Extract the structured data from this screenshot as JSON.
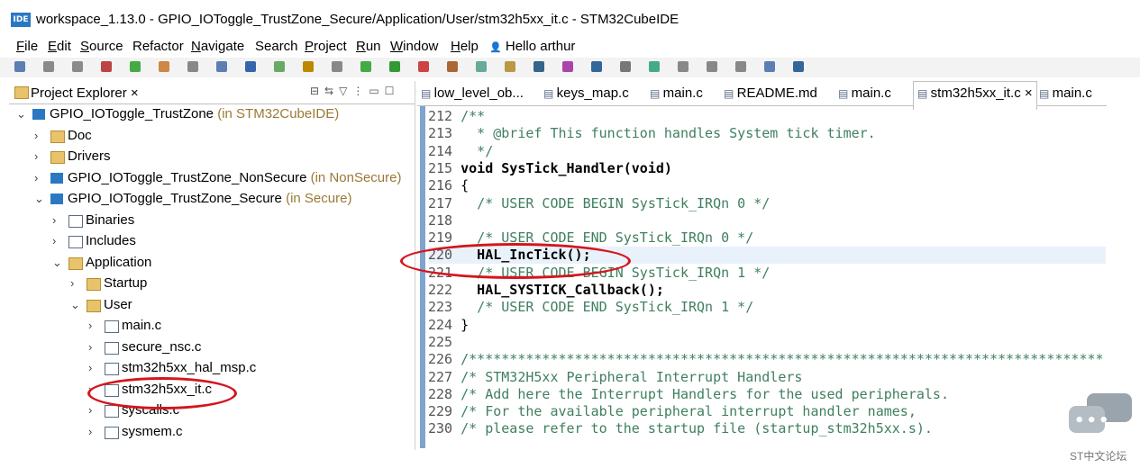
{
  "window": {
    "logo": "IDE",
    "title": "workspace_1.13.0 - GPIO_IOToggle_TrustZone_Secure/Application/User/stm32h5xx_it.c - STM32CubeIDE"
  },
  "menu": [
    {
      "label": "File",
      "key": "F",
      "rest": "ile"
    },
    {
      "label": "Edit",
      "key": "E",
      "rest": "dit"
    },
    {
      "label": "Source",
      "key": "S",
      "rest": "ource"
    },
    {
      "label": "Refactor",
      "key": "",
      "rest": "Refactor"
    },
    {
      "label": "Navigate",
      "key": "N",
      "rest": "avigate"
    },
    {
      "label": "Search",
      "key": "",
      "rest": "Search"
    },
    {
      "label": "Project",
      "key": "P",
      "rest": "roject"
    },
    {
      "label": "Run",
      "key": "R",
      "rest": "un"
    },
    {
      "label": "Window",
      "key": "W",
      "rest": "indow"
    },
    {
      "label": "Help",
      "key": "H",
      "rest": "elp"
    },
    {
      "label": "Hello arthur",
      "key": "",
      "rest": "Hello arthur"
    }
  ],
  "explorer": {
    "title": "Project Explorer",
    "close": "×",
    "items": [
      {
        "name": "GPIO_IOToggle_TrustZone",
        "suffix": " (in STM32CubeIDE)",
        "icon": "project-icon"
      },
      {
        "name": "Doc",
        "suffix": "",
        "icon": "folder-icon"
      },
      {
        "name": "Drivers",
        "suffix": "",
        "icon": "folder-icon"
      },
      {
        "name": "GPIO_IOToggle_TrustZone_NonSecure",
        "suffix": " (in NonSecure)",
        "icon": "project-icon"
      },
      {
        "name": "GPIO_IOToggle_TrustZone_Secure",
        "suffix": " (in Secure)",
        "icon": "project-icon"
      },
      {
        "name": "Binaries",
        "suffix": "",
        "icon": "binaries-icon"
      },
      {
        "name": "Includes",
        "suffix": "",
        "icon": "includes-icon"
      },
      {
        "name": "Application",
        "suffix": "",
        "icon": "folder-icon"
      },
      {
        "name": "Startup",
        "suffix": "",
        "icon": "folder-icon"
      },
      {
        "name": "User",
        "suffix": "",
        "icon": "folder-icon"
      },
      {
        "name": "main.c",
        "suffix": "",
        "icon": "c-file-icon"
      },
      {
        "name": "secure_nsc.c",
        "suffix": "",
        "icon": "c-file-icon"
      },
      {
        "name": "stm32h5xx_hal_msp.c",
        "suffix": "",
        "icon": "c-file-icon"
      },
      {
        "name": "stm32h5xx_it.c",
        "suffix": "",
        "icon": "c-file-icon"
      },
      {
        "name": "syscalls.c",
        "suffix": "",
        "icon": "c-file-icon"
      },
      {
        "name": "sysmem.c",
        "suffix": "",
        "icon": "c-file-icon"
      }
    ]
  },
  "tabs": [
    {
      "label": "low_level_ob..."
    },
    {
      "label": "keys_map.c"
    },
    {
      "label": "main.c"
    },
    {
      "label": "README.md"
    },
    {
      "label": "main.c"
    },
    {
      "label": "stm32h5xx_it.c ×"
    },
    {
      "label": "main.c"
    }
  ],
  "code": [
    {
      "n": "212",
      "t": "/**"
    },
    {
      "n": "213",
      "t": "  * @brief This function handles System tick timer."
    },
    {
      "n": "214",
      "t": "  */"
    },
    {
      "n": "215",
      "t": "void SysTick_Handler(void)"
    },
    {
      "n": "216",
      "t": "{"
    },
    {
      "n": "217",
      "t": "  /* USER CODE BEGIN SysTick_IRQn 0 */"
    },
    {
      "n": "218",
      "t": ""
    },
    {
      "n": "219",
      "t": "  /* USER CODE END SysTick_IRQn 0 */"
    },
    {
      "n": "220",
      "t": "  HAL_IncTick();"
    },
    {
      "n": "221",
      "t": "  /* USER CODE BEGIN SysTick_IRQn 1 */"
    },
    {
      "n": "222",
      "t": "  HAL_SYSTICK_Callback();"
    },
    {
      "n": "223",
      "t": "  /* USER CODE END SysTick_IRQn 1 */"
    },
    {
      "n": "224",
      "t": "}"
    },
    {
      "n": "225",
      "t": ""
    },
    {
      "n": "226",
      "t": "/******************************************************************************"
    },
    {
      "n": "227",
      "t": "/* STM32H5xx Peripheral Interrupt Handlers"
    },
    {
      "n": "228",
      "t": "/* Add here the Interrupt Handlers for the used peripherals."
    },
    {
      "n": "229",
      "t": "/* For the available peripheral interrupt handler names,"
    },
    {
      "n": "230",
      "t": "/* please refer to the startup file (startup_stm32h5xx.s)."
    }
  ],
  "watermark": "ST中文论坛",
  "colors": {
    "keyword": "#7f0055",
    "comment": "#3f7f5f",
    "annotation": "#d4151d",
    "current_line": "#e9f1fb"
  }
}
